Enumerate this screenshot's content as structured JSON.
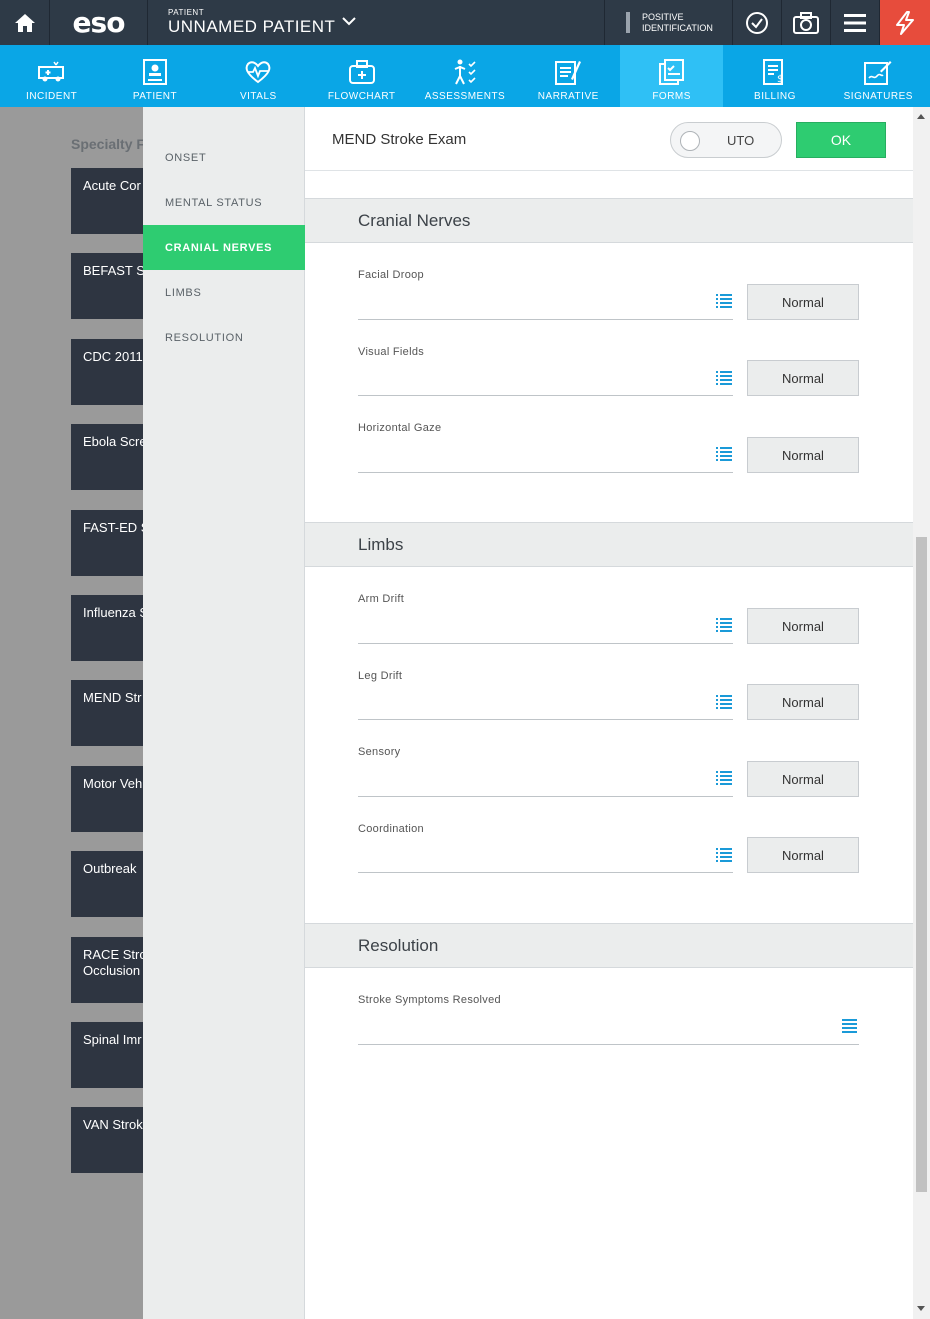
{
  "topbar": {
    "logo": "eso",
    "patient_label": "PATIENT",
    "patient_name": "UNNAMED PATIENT",
    "positive_id": "POSITIVE IDENTIFICATION"
  },
  "nav": [
    {
      "label": "INCIDENT",
      "icon": "ambulance-icon"
    },
    {
      "label": "PATIENT",
      "icon": "patient-card-icon"
    },
    {
      "label": "VITALS",
      "icon": "heartbeat-icon"
    },
    {
      "label": "FLOWCHART",
      "icon": "medkit-icon"
    },
    {
      "label": "ASSESSMENTS",
      "icon": "body-checklist-icon"
    },
    {
      "label": "NARRATIVE",
      "icon": "notepad-icon"
    },
    {
      "label": "FORMS",
      "icon": "forms-icon",
      "active": true
    },
    {
      "label": "BILLING",
      "icon": "billing-icon"
    },
    {
      "label": "SIGNATURES",
      "icon": "signature-icon"
    }
  ],
  "background": {
    "heading": "Specialty F",
    "cards": [
      "Acute Cor",
      "BEFAST St",
      "CDC 2011",
      "Ebola Scre",
      "FAST-ED S",
      "Influenza S",
      "MEND Str",
      "Motor Veh",
      "Outbreak",
      "RACE Stro\nOcclusion",
      "Spinal Imr",
      "VAN Strok"
    ]
  },
  "sidebar": {
    "items": [
      "ONSET",
      "MENTAL STATUS",
      "CRANIAL NERVES",
      "LIMBS",
      "RESOLUTION"
    ],
    "active_index": 2
  },
  "form": {
    "title": "MEND Stroke Exam",
    "uto_label": "UTO",
    "ok_label": "OK",
    "sections": [
      {
        "title": "Cranial Nerves",
        "fields": [
          "Facial Droop",
          "Visual Fields",
          "Horizontal Gaze"
        ]
      },
      {
        "title": "Limbs",
        "fields": [
          "Arm Drift",
          "Leg Drift",
          "Sensory",
          "Coordination"
        ]
      },
      {
        "title": "Resolution",
        "fields": [
          "Stroke Symptoms Resolved"
        ]
      }
    ],
    "normal_label": "Normal"
  },
  "colors": {
    "topbar": "#2e3a47",
    "nav": "#0aa6e6",
    "nav_active": "#2fc0f5",
    "accent_green": "#2ecc71",
    "alert_red": "#e74c3c"
  }
}
